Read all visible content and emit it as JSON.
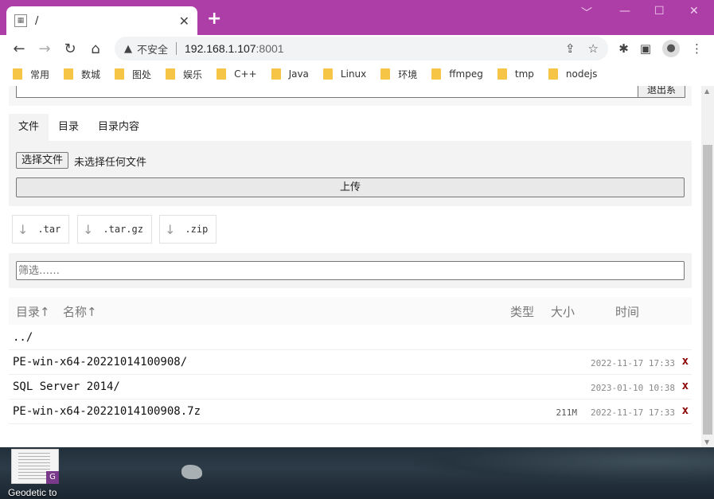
{
  "browser": {
    "tab_title": "/",
    "tab_close": "✕",
    "new_tab": "+",
    "insecure_label": "不安全",
    "url_host": "192.168.1.107",
    "url_port": ":8001",
    "window_controls": {
      "minimize": "﹀",
      "restore": "—",
      "maximize": "☐",
      "close": "✕"
    }
  },
  "bookmarks": [
    "常用",
    "数城",
    "图处",
    "娱乐",
    "C++",
    "Java",
    "Linux",
    "环境",
    "ffmpeg",
    "tmp",
    "nodejs"
  ],
  "page": {
    "top_button": "退出系",
    "tabs": [
      "文件",
      "目录",
      "目录内容"
    ],
    "file_button": "选择文件",
    "file_none": "未选择任何文件",
    "upload_button": "上传",
    "downloads": [
      ".tar",
      ".tar.gz",
      ".zip"
    ],
    "filter_placeholder": "筛选……",
    "headers": {
      "dir": "目录↑",
      "name": "名称↑",
      "type": "类型",
      "size": "大小",
      "time": "时间"
    },
    "rows": [
      {
        "name": "../",
        "size": "",
        "time": "",
        "del": ""
      },
      {
        "name": "PE-win-x64-20221014100908/",
        "size": "",
        "time": "2022-11-17 17:33",
        "del": "x"
      },
      {
        "name": "SQL Server 2014/",
        "size": "",
        "time": "2023-01-10 10:38",
        "del": "x"
      },
      {
        "name": "PE-win-x64-20221014100908.7z",
        "size": "211M",
        "time": "2022-11-17 17:33",
        "del": "x"
      }
    ]
  },
  "desktop": {
    "icon_label": "Geodetic to"
  },
  "colors": {
    "titlebar": "#ae3ea7",
    "delete": "#8b0000",
    "bookmark_folder": "#f6c545"
  }
}
